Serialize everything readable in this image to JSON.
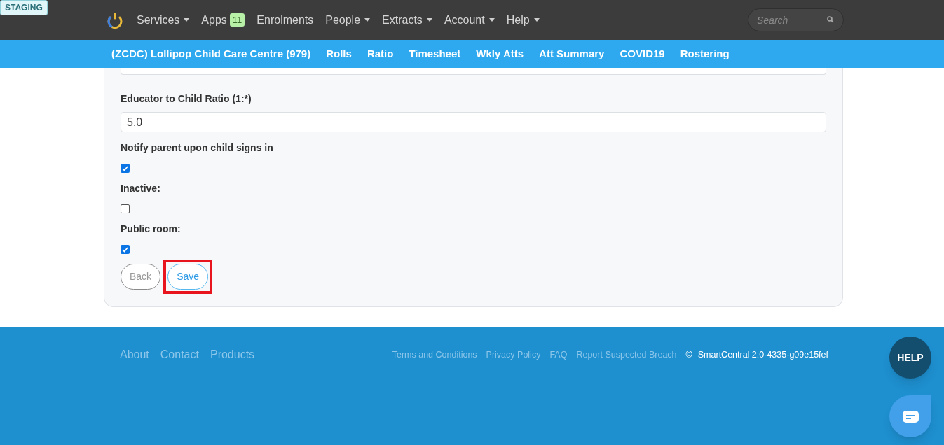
{
  "environment_badge": "STAGING",
  "top_nav": [
    {
      "label": "Services",
      "dropdown": true
    },
    {
      "label": "Apps",
      "dropdown": false,
      "badge": "11"
    },
    {
      "label": "Enrolments",
      "dropdown": false
    },
    {
      "label": "People",
      "dropdown": true
    },
    {
      "label": "Extracts",
      "dropdown": true
    },
    {
      "label": "Account",
      "dropdown": true
    },
    {
      "label": "Help",
      "dropdown": true
    }
  ],
  "search": {
    "placeholder": "Search"
  },
  "sub_nav": [
    {
      "label": "(ZCDC) Lollipop Child Care Centre (979)"
    },
    {
      "label": "Rolls"
    },
    {
      "label": "Ratio"
    },
    {
      "label": "Timesheet"
    },
    {
      "label": "Wkly Atts"
    },
    {
      "label": "Att Summary"
    },
    {
      "label": "COVID19"
    },
    {
      "label": "Rostering"
    }
  ],
  "form": {
    "fields": [
      {
        "kind": "text",
        "label": "Educator to Child Ratio (1:*)",
        "value": "5.0"
      },
      {
        "kind": "checkbox",
        "label": "Notify parent upon child signs in",
        "checked": true
      },
      {
        "kind": "checkbox",
        "label": "Inactive:",
        "checked": false
      },
      {
        "kind": "checkbox",
        "label": "Public room:",
        "checked": true
      }
    ],
    "buttons": [
      {
        "label": "Back",
        "kind": "secondary",
        "highlighted": false
      },
      {
        "label": "Save",
        "kind": "primary",
        "highlighted": true
      }
    ]
  },
  "footer": {
    "left_links": [
      "About",
      "Contact",
      "Products"
    ],
    "right_links": [
      "Terms and Conditions",
      "Privacy Policy",
      "FAQ",
      "Report Suspected Breach"
    ],
    "copyright_symbol": "©",
    "version": "SmartCentral 2.0-4335-g09e15fef"
  },
  "help_button": "HELP"
}
